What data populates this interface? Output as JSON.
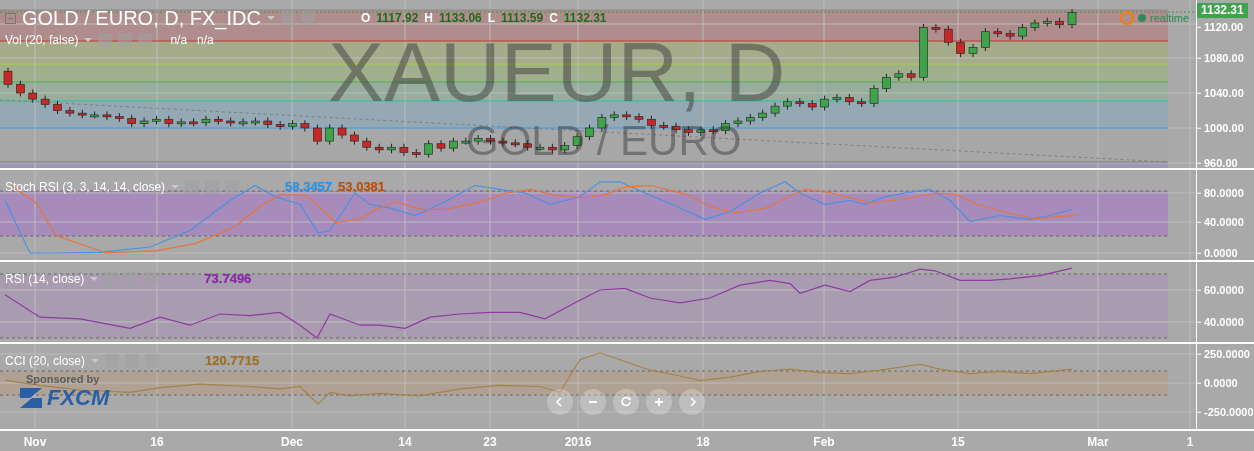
{
  "header": {
    "symbol": "GOLD / EURO, D, FX_IDC",
    "ohlc": [
      {
        "label": "O",
        "value": "1117.92"
      },
      {
        "label": "H",
        "value": "1133.06"
      },
      {
        "label": "L",
        "value": "1113.59"
      },
      {
        "label": "C",
        "value": "1132.31"
      }
    ]
  },
  "volume": {
    "title": "Vol (20, false)",
    "values": [
      "n/a",
      "n/a"
    ]
  },
  "watermark": {
    "symbol": "XAUEUR, D",
    "description": "GOLD / EURO"
  },
  "price_label": "1132.31",
  "status": {
    "label": "realtime",
    "warning": true
  },
  "price_axis": [
    "1120.00",
    "1080.00",
    "1040.00",
    "1000.00",
    "960.00"
  ],
  "indicators": [
    {
      "kind": "stoch",
      "title": "Stoch RSI (3, 3, 14, 14, close)",
      "values": [
        {
          "text": "58.3457",
          "color": "#2196f3"
        },
        {
          "text": "53.0381",
          "color": "#c94f00"
        }
      ],
      "axis": [
        "80.0000",
        "40.0000",
        "0.0000"
      ]
    },
    {
      "kind": "rsi",
      "title": "RSI (14, close)",
      "values": [
        {
          "text": "73.7496",
          "color": "#8e24aa"
        }
      ],
      "axis": [
        "60.0000",
        "40.0000"
      ]
    },
    {
      "kind": "cci",
      "title": "CCI (20, close)",
      "values": [
        {
          "text": "120.7715",
          "color": "#a5701e"
        }
      ],
      "axis": [
        "250.0000",
        "0.0000",
        "-250.0000"
      ]
    }
  ],
  "sponsor": {
    "caption": "Sponsored by",
    "logo": "FXCM"
  },
  "time_axis": [
    "Nov",
    "16",
    "Dec",
    "14",
    "23",
    "2016",
    "18",
    "Feb",
    "15",
    "Mar",
    "1"
  ]
}
